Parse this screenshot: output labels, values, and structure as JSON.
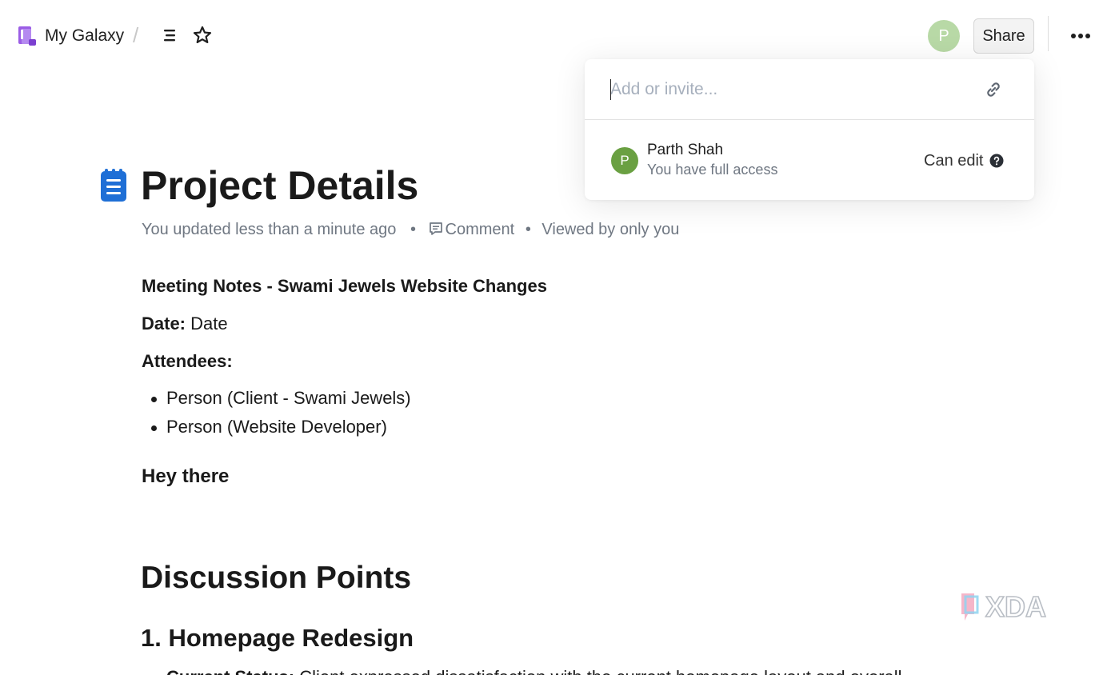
{
  "topbar": {
    "workspace_name": "My Galaxy",
    "breadcrumb_separator": "/",
    "user_avatar_letter": "P",
    "share_label": "Share",
    "icons": [
      "workspace-icon",
      "outline-icon",
      "star-icon",
      "more-icon"
    ]
  },
  "share_popover": {
    "invite_placeholder": "Add or invite...",
    "invite_value": "",
    "members": [
      {
        "avatar_letter": "P",
        "name": "Parth Shah",
        "access": "You have full access",
        "permission": "Can edit"
      }
    ]
  },
  "document": {
    "title": "Project Details",
    "meta": {
      "updated": "You updated less than a minute ago",
      "separator": "•",
      "comment_label": "Comment",
      "viewed": "Viewed by only you"
    },
    "meeting_heading": "Meeting Notes - Swami Jewels Website Changes",
    "date_label": "Date:",
    "date_value": "Date",
    "attendees_label": "Attendees:",
    "attendees": [
      "Person (Client - Swami Jewels)",
      "Person (Website Developer)"
    ],
    "greeting": "Hey there",
    "section_heading": "Discussion Points",
    "subsection_heading": "1. Homepage Redesign",
    "cut_line_label": "Current Status:",
    "cut_line_text": "Client expressed dissatisfaction with the current homepage layout and overall"
  },
  "watermark": {
    "text": "XDA"
  },
  "colors": {
    "accent_blue": "#1f6fd6",
    "workspace_purple": "#9b5de5",
    "avatar_light_green": "#b8d9a6",
    "avatar_green": "#6aa042",
    "muted_text": "#6f7782"
  }
}
